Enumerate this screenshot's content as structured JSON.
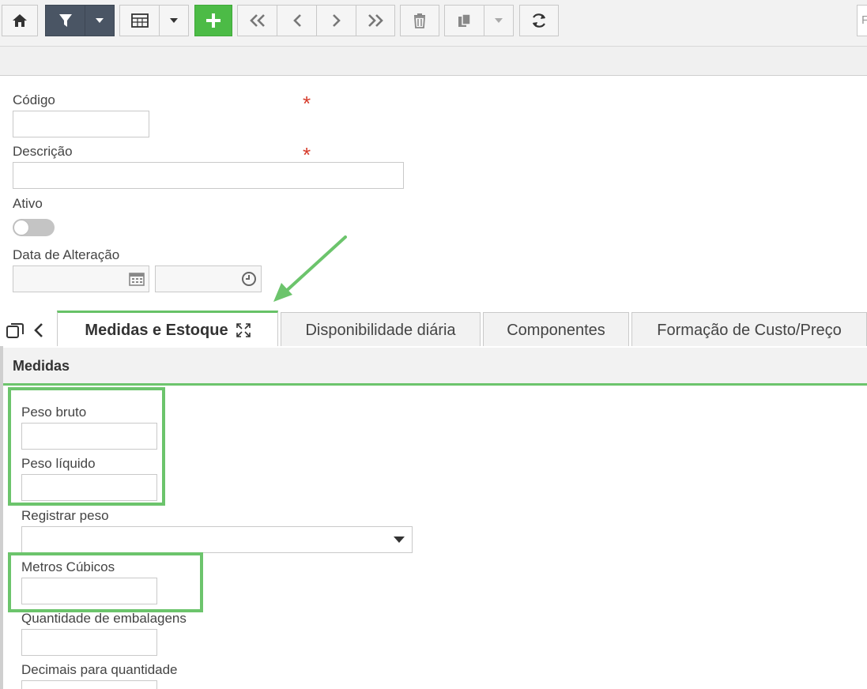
{
  "toolbar": {
    "buttons": [
      {
        "name": "home-button",
        "icon": "home-icon"
      },
      {
        "name": "filter-button",
        "icon": "filter-icon"
      },
      {
        "name": "filter-dropdown-button",
        "icon": "caret-down-icon"
      },
      {
        "name": "grid-view-button",
        "icon": "table-icon"
      },
      {
        "name": "grid-view-dropdown-button",
        "icon": "caret-down-icon"
      },
      {
        "name": "add-button",
        "icon": "plus-icon"
      },
      {
        "name": "first-record-button",
        "icon": "double-chevron-left-icon"
      },
      {
        "name": "previous-record-button",
        "icon": "chevron-left-icon"
      },
      {
        "name": "next-record-button",
        "icon": "chevron-right-icon"
      },
      {
        "name": "last-record-button",
        "icon": "double-chevron-right-icon"
      },
      {
        "name": "delete-button",
        "icon": "trash-icon"
      },
      {
        "name": "copy-button",
        "icon": "copy-icon"
      },
      {
        "name": "copy-dropdown-button",
        "icon": "caret-down-icon"
      },
      {
        "name": "refresh-button",
        "icon": "refresh-icon"
      }
    ],
    "search_placeholder": "F"
  },
  "form": {
    "codigo_label": "Código",
    "descricao_label": "Descrição",
    "ativo_label": "Ativo",
    "data_alteracao_label": "Data de Alteração",
    "required_mark": "*"
  },
  "tabs": [
    {
      "label": "Medidas e Estoque",
      "active": true
    },
    {
      "label": "Disponibilidade diária",
      "active": false
    },
    {
      "label": "Componentes",
      "active": false
    },
    {
      "label": "Formação de Custo/Preço",
      "active": false
    }
  ],
  "section": {
    "title": "Medidas",
    "fields": {
      "peso_bruto": "Peso bruto",
      "peso_liquido": "Peso líquido",
      "registrar_peso": "Registrar peso",
      "metros_cubicos": "Metros Cúbicos",
      "quantidade_embalagens": "Quantidade de embalagens",
      "decimais_quantidade": "Decimais para quantidade"
    }
  },
  "colors": {
    "accent_green": "#4cbb46",
    "highlight_green": "#6cc46c",
    "toolbar_dark": "#4a5564",
    "required_red": "#d63a2a"
  }
}
